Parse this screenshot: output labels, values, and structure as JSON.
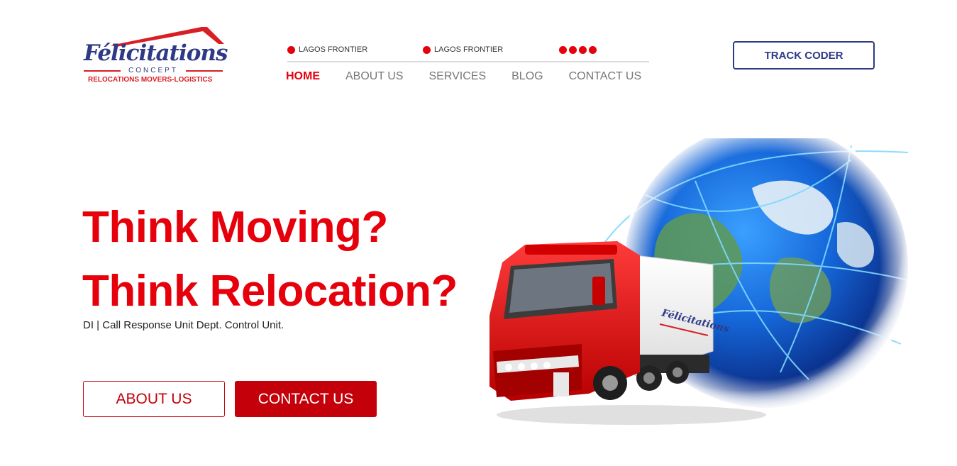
{
  "brand": {
    "name": "Félicitations",
    "concept": "CONCEPT",
    "tagline": "RELOCATIONS MOVERS-LOGISTICS",
    "colors": {
      "navy": "#2e3a86",
      "red": "#d81f26"
    }
  },
  "topbar": {
    "items": [
      {
        "label": "LAGOS FRONTIER",
        "icon": "red-dot-icon"
      },
      {
        "label": "LAGOS FRONTIER",
        "icon": "red-dot-icon"
      }
    ],
    "indicator_dots": 4
  },
  "nav": {
    "items": [
      {
        "label": "HOME",
        "active": true
      },
      {
        "label": "ABOUT US",
        "active": false
      },
      {
        "label": "SERVICES",
        "active": false
      },
      {
        "label": "BLOG",
        "active": false
      },
      {
        "label": "CONTACT US",
        "active": false
      }
    ]
  },
  "header": {
    "track_label": "TRACK CODER"
  },
  "hero": {
    "line1": "Think Moving?",
    "line2": "Think Relocation?",
    "subtext": "DI | Call Response Unit Dept. Control Unit.",
    "about_label": "ABOUT US",
    "contact_label": "CONTACT US",
    "truck_brand": "Félicitations",
    "accent_color": "#e5000c"
  }
}
